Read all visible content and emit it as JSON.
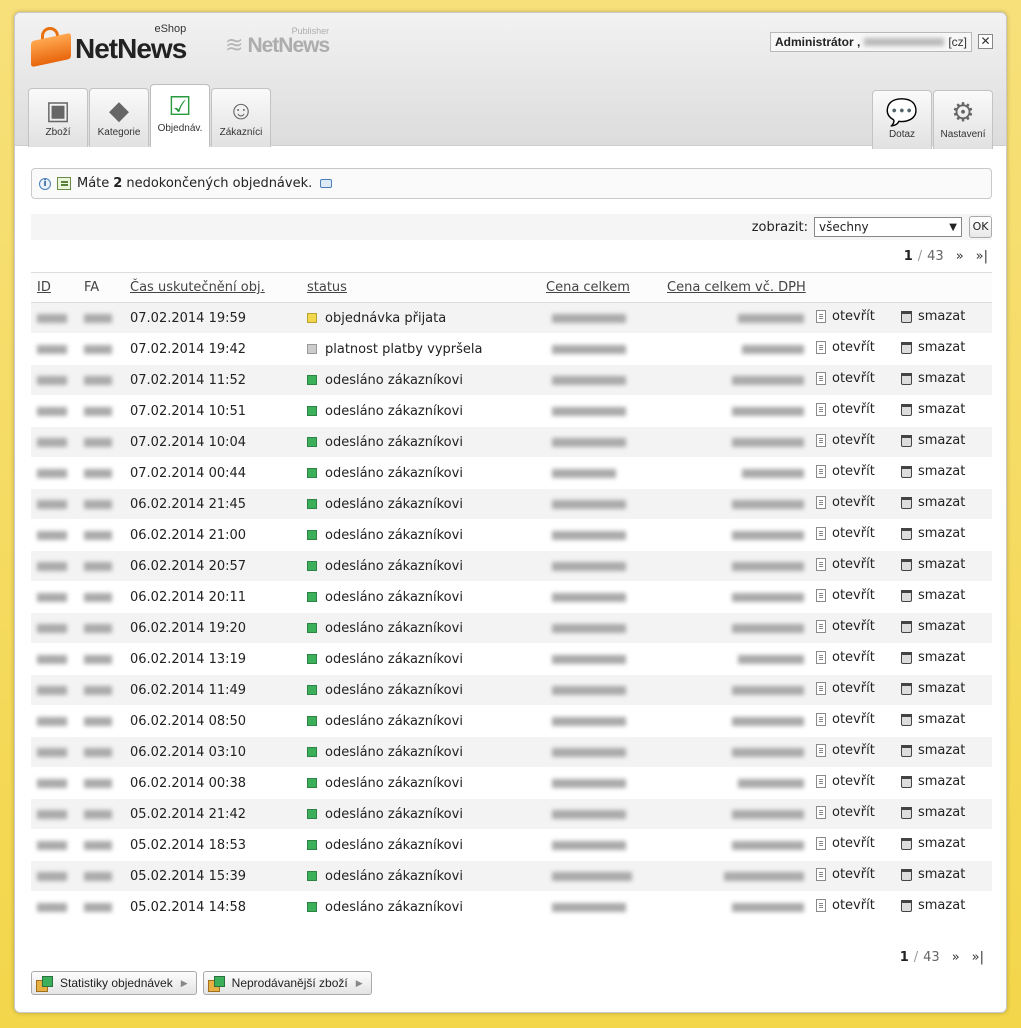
{
  "header": {
    "logo_text": "NetNews",
    "logo_sub": "eShop",
    "logo2_text": "NetNews",
    "logo2_sub": "Publisher",
    "user_prefix": "Administrátor ,",
    "user_lang": "[cz]",
    "close_label": "✕"
  },
  "tabs": [
    {
      "label": "Zboží",
      "icon": "product-icon"
    },
    {
      "label": "Kategorie",
      "icon": "category-icon"
    },
    {
      "label": "Objednáv.",
      "icon": "orders-icon"
    },
    {
      "label": "Zákazníci",
      "icon": "customers-icon"
    }
  ],
  "rtabs": [
    {
      "label": "Dotaz",
      "icon": "chat-icon"
    },
    {
      "label": "Nastavení",
      "icon": "gear-icon"
    }
  ],
  "info": {
    "pre": "Máte",
    "count": "2",
    "post": "nedokončených objednávek."
  },
  "filter": {
    "label": "zobrazit:",
    "value": "všechny",
    "ok": "OK"
  },
  "pager": {
    "current": "1",
    "sep": "/",
    "total": "43",
    "next": "»",
    "last": "»|"
  },
  "columns": {
    "id": "ID",
    "fa": "FA",
    "time": "Čas uskutečnění obj.",
    "status": "status",
    "price": "Cena celkem",
    "price_vat": "Cena celkem vč. DPH"
  },
  "actions": {
    "open": "otevřít",
    "delete": "smazat"
  },
  "rows": [
    {
      "time": "07.02.2014 19:59",
      "status": "objednávka přijata",
      "color": "yellow"
    },
    {
      "time": "07.02.2014 19:42",
      "status": "platnost platby vypršela",
      "color": "gray"
    },
    {
      "time": "07.02.2014 11:52",
      "status": "odesláno zákazníkovi",
      "color": "green"
    },
    {
      "time": "07.02.2014 10:51",
      "status": "odesláno zákazníkovi",
      "color": "green"
    },
    {
      "time": "07.02.2014 10:04",
      "status": "odesláno zákazníkovi",
      "color": "green"
    },
    {
      "time": "07.02.2014 00:44",
      "status": "odesláno zákazníkovi",
      "color": "green"
    },
    {
      "time": "06.02.2014 21:45",
      "status": "odesláno zákazníkovi",
      "color": "green"
    },
    {
      "time": "06.02.2014 21:00",
      "status": "odesláno zákazníkovi",
      "color": "green"
    },
    {
      "time": "06.02.2014 20:57",
      "status": "odesláno zákazníkovi",
      "color": "green"
    },
    {
      "time": "06.02.2014 20:11",
      "status": "odesláno zákazníkovi",
      "color": "green"
    },
    {
      "time": "06.02.2014 19:20",
      "status": "odesláno zákazníkovi",
      "color": "green"
    },
    {
      "time": "06.02.2014 13:19",
      "status": "odesláno zákazníkovi",
      "color": "green"
    },
    {
      "time": "06.02.2014 11:49",
      "status": "odesláno zákazníkovi",
      "color": "green"
    },
    {
      "time": "06.02.2014 08:50",
      "status": "odesláno zákazníkovi",
      "color": "green"
    },
    {
      "time": "06.02.2014 03:10",
      "status": "odesláno zákazníkovi",
      "color": "green"
    },
    {
      "time": "06.02.2014 00:38",
      "status": "odesláno zákazníkovi",
      "color": "green"
    },
    {
      "time": "05.02.2014 21:42",
      "status": "odesláno zákazníkovi",
      "color": "green"
    },
    {
      "time": "05.02.2014 18:53",
      "status": "odesláno zákazníkovi",
      "color": "green"
    },
    {
      "time": "05.02.2014 15:39",
      "status": "odesláno zákazníkovi",
      "color": "green"
    },
    {
      "time": "05.02.2014 14:58",
      "status": "odesláno zákazníkovi",
      "color": "green"
    }
  ],
  "bottom_buttons": [
    {
      "label": "Statistiky objednávek"
    },
    {
      "label": "Neprodávanější zboží"
    }
  ]
}
